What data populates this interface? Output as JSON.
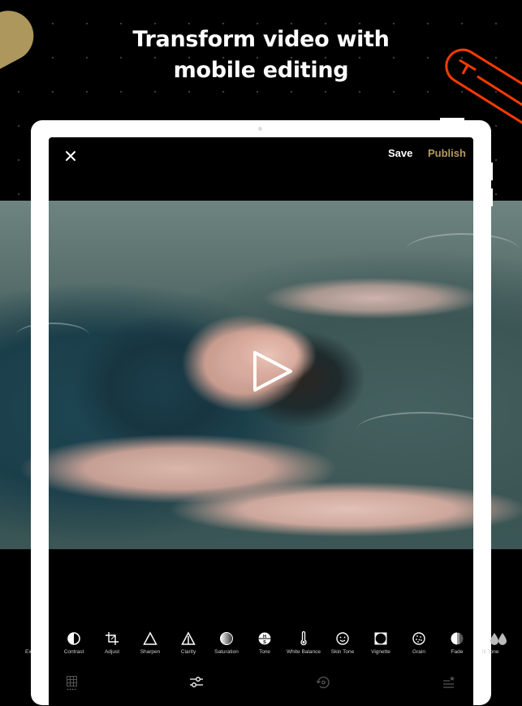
{
  "headline": {
    "line1": "Transform video with",
    "line2": "mobile editing"
  },
  "colors": {
    "accent_gold": "#b59a5d",
    "decor_blob": "#ad975c",
    "decor_clip": "#ff3b00",
    "background": "#000000",
    "device": "#ffffff"
  },
  "editor": {
    "close_icon": "close-icon",
    "save_label": "Save",
    "publish_label": "Publish",
    "play_icon": "play-icon"
  },
  "tools": [
    {
      "label": "Exposure",
      "visible": "Ex",
      "icon": "exposure-icon"
    },
    {
      "label": "Contrast",
      "icon": "contrast-icon"
    },
    {
      "label": "Adjust",
      "icon": "crop-icon"
    },
    {
      "label": "Sharpen",
      "icon": "triangle-icon"
    },
    {
      "label": "Clarity",
      "icon": "clarity-icon"
    },
    {
      "label": "Saturation",
      "icon": "saturation-icon"
    },
    {
      "label": "Tone",
      "icon": "tone-icon"
    },
    {
      "label": "White Balance",
      "icon": "thermometer-icon"
    },
    {
      "label": "Skin Tone",
      "icon": "smiley-icon"
    },
    {
      "label": "Vignette",
      "icon": "vignette-icon"
    },
    {
      "label": "Grain",
      "icon": "grain-icon"
    },
    {
      "label": "Fade",
      "icon": "fade-icon"
    },
    {
      "label": "Split Tone",
      "visible": "lit Tone",
      "icon": "split-tone-icon"
    }
  ],
  "bottom_nav": [
    {
      "name": "presets",
      "icon": "grid-icon"
    },
    {
      "name": "tools",
      "icon": "sliders-icon",
      "active": true
    },
    {
      "name": "history",
      "icon": "history-icon"
    },
    {
      "name": "recipes",
      "icon": "recipes-icon"
    }
  ]
}
